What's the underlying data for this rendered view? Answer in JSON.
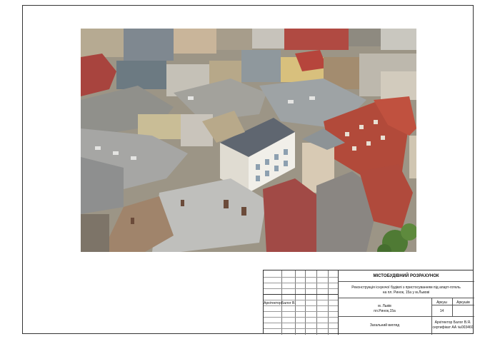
{
  "title_block": {
    "main_title": "МІСТОБУДІВНИЙ РОЗРАХУНОК",
    "project_line1": "Реконструкція існуючої будівлі з пристосуванням під апарт-готель",
    "project_line2": "на пл. Ринок, 15а у м.Львові",
    "role_label": "Архітектор",
    "role_name": "Балог В.",
    "location_line1": "м. Львів",
    "location_line2": "пл.Ринок,15а",
    "sheet_label": "Аркуш",
    "sheets_label": "Аркушів",
    "sheet_number": "14",
    "drawing_name": "Загальний вигляд",
    "author_line1": "Архітектор Балог В.Я.",
    "author_line2": "сертифікат АА №003460"
  }
}
